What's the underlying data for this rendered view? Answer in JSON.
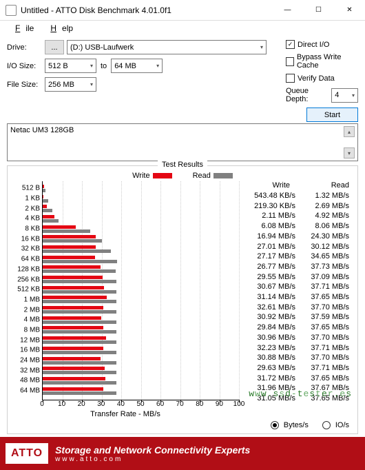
{
  "window": {
    "title": "Untitled - ATTO Disk Benchmark 4.01.0f1",
    "min": "—",
    "max": "☐",
    "close": "✕"
  },
  "menu": {
    "file": "File",
    "help": "Help"
  },
  "controls": {
    "drive_label": "Drive:",
    "drive_dots": "...",
    "drive_value": "(D:) USB-Laufwerk",
    "io_label": "I/O Size:",
    "io_from": "512 B",
    "io_to_lbl": "to",
    "io_to": "64 MB",
    "fs_label": "File Size:",
    "fs_value": "256 MB",
    "direct_io": "Direct I/O",
    "bypass": "Bypass Write Cache",
    "verify": "Verify Data",
    "qd_label": "Queue Depth:",
    "qd_value": "4",
    "start": "Start"
  },
  "desc": {
    "text": "Netac UM3 128GB"
  },
  "results": {
    "frame_title": "Test Results",
    "legend_write": "Write",
    "legend_read": "Read",
    "hdr_write": "Write",
    "hdr_read": "Read",
    "xlabel": "Transfer Rate - MB/s",
    "unit_bytes": "Bytes/s",
    "unit_ios": "IO/s"
  },
  "chart_data": {
    "type": "bar",
    "xlabel": "Transfer Rate - MB/s",
    "xlim": [
      0,
      100
    ],
    "xticks": [
      0,
      10,
      20,
      30,
      40,
      50,
      60,
      70,
      80,
      90,
      100
    ],
    "series": [
      {
        "name": "Write",
        "color": "#e40613"
      },
      {
        "name": "Read",
        "color": "#808080"
      }
    ],
    "rows": [
      {
        "label": "512 B",
        "write_val": 0.54348,
        "read_val": 1.32,
        "write_txt": "543.48 KB/s",
        "read_txt": "1.32 MB/s"
      },
      {
        "label": "1 KB",
        "write_val": 0.2193,
        "read_val": 2.69,
        "write_txt": "219.30 KB/s",
        "read_txt": "2.69 MB/s"
      },
      {
        "label": "2 KB",
        "write_val": 2.11,
        "read_val": 4.92,
        "write_txt": "2.11 MB/s",
        "read_txt": "4.92 MB/s"
      },
      {
        "label": "4 KB",
        "write_val": 6.08,
        "read_val": 8.06,
        "write_txt": "6.08 MB/s",
        "read_txt": "8.06 MB/s"
      },
      {
        "label": "8 KB",
        "write_val": 16.94,
        "read_val": 24.3,
        "write_txt": "16.94 MB/s",
        "read_txt": "24.30 MB/s"
      },
      {
        "label": "16 KB",
        "write_val": 27.01,
        "read_val": 30.12,
        "write_txt": "27.01 MB/s",
        "read_txt": "30.12 MB/s"
      },
      {
        "label": "32 KB",
        "write_val": 27.17,
        "read_val": 34.65,
        "write_txt": "27.17 MB/s",
        "read_txt": "34.65 MB/s"
      },
      {
        "label": "64 KB",
        "write_val": 26.77,
        "read_val": 37.73,
        "write_txt": "26.77 MB/s",
        "read_txt": "37.73 MB/s"
      },
      {
        "label": "128 KB",
        "write_val": 29.55,
        "read_val": 37.09,
        "write_txt": "29.55 MB/s",
        "read_txt": "37.09 MB/s"
      },
      {
        "label": "256 KB",
        "write_val": 30.67,
        "read_val": 37.71,
        "write_txt": "30.67 MB/s",
        "read_txt": "37.71 MB/s"
      },
      {
        "label": "512 KB",
        "write_val": 31.14,
        "read_val": 37.65,
        "write_txt": "31.14 MB/s",
        "read_txt": "37.65 MB/s"
      },
      {
        "label": "1 MB",
        "write_val": 32.61,
        "read_val": 37.7,
        "write_txt": "32.61 MB/s",
        "read_txt": "37.70 MB/s"
      },
      {
        "label": "2 MB",
        "write_val": 30.92,
        "read_val": 37.59,
        "write_txt": "30.92 MB/s",
        "read_txt": "37.59 MB/s"
      },
      {
        "label": "4 MB",
        "write_val": 29.84,
        "read_val": 37.65,
        "write_txt": "29.84 MB/s",
        "read_txt": "37.65 MB/s"
      },
      {
        "label": "8 MB",
        "write_val": 30.96,
        "read_val": 37.7,
        "write_txt": "30.96 MB/s",
        "read_txt": "37.70 MB/s"
      },
      {
        "label": "12 MB",
        "write_val": 32.23,
        "read_val": 37.71,
        "write_txt": "32.23 MB/s",
        "read_txt": "37.71 MB/s"
      },
      {
        "label": "16 MB",
        "write_val": 30.88,
        "read_val": 37.7,
        "write_txt": "30.88 MB/s",
        "read_txt": "37.70 MB/s"
      },
      {
        "label": "24 MB",
        "write_val": 29.63,
        "read_val": 37.71,
        "write_txt": "29.63 MB/s",
        "read_txt": "37.71 MB/s"
      },
      {
        "label": "32 MB",
        "write_val": 31.72,
        "read_val": 37.65,
        "write_txt": "31.72 MB/s",
        "read_txt": "37.65 MB/s"
      },
      {
        "label": "48 MB",
        "write_val": 31.96,
        "read_val": 37.67,
        "write_txt": "31.96 MB/s",
        "read_txt": "37.67 MB/s"
      },
      {
        "label": "64 MB",
        "write_val": 31.05,
        "read_val": 37.65,
        "write_txt": "31.05 MB/s",
        "read_txt": "37.65 MB/s"
      }
    ]
  },
  "footer": {
    "logo": "ATTO",
    "line1": "Storage and Network Connectivity Experts",
    "line2": "www.atto.com"
  },
  "watermark": "www.ssd-tester.es"
}
